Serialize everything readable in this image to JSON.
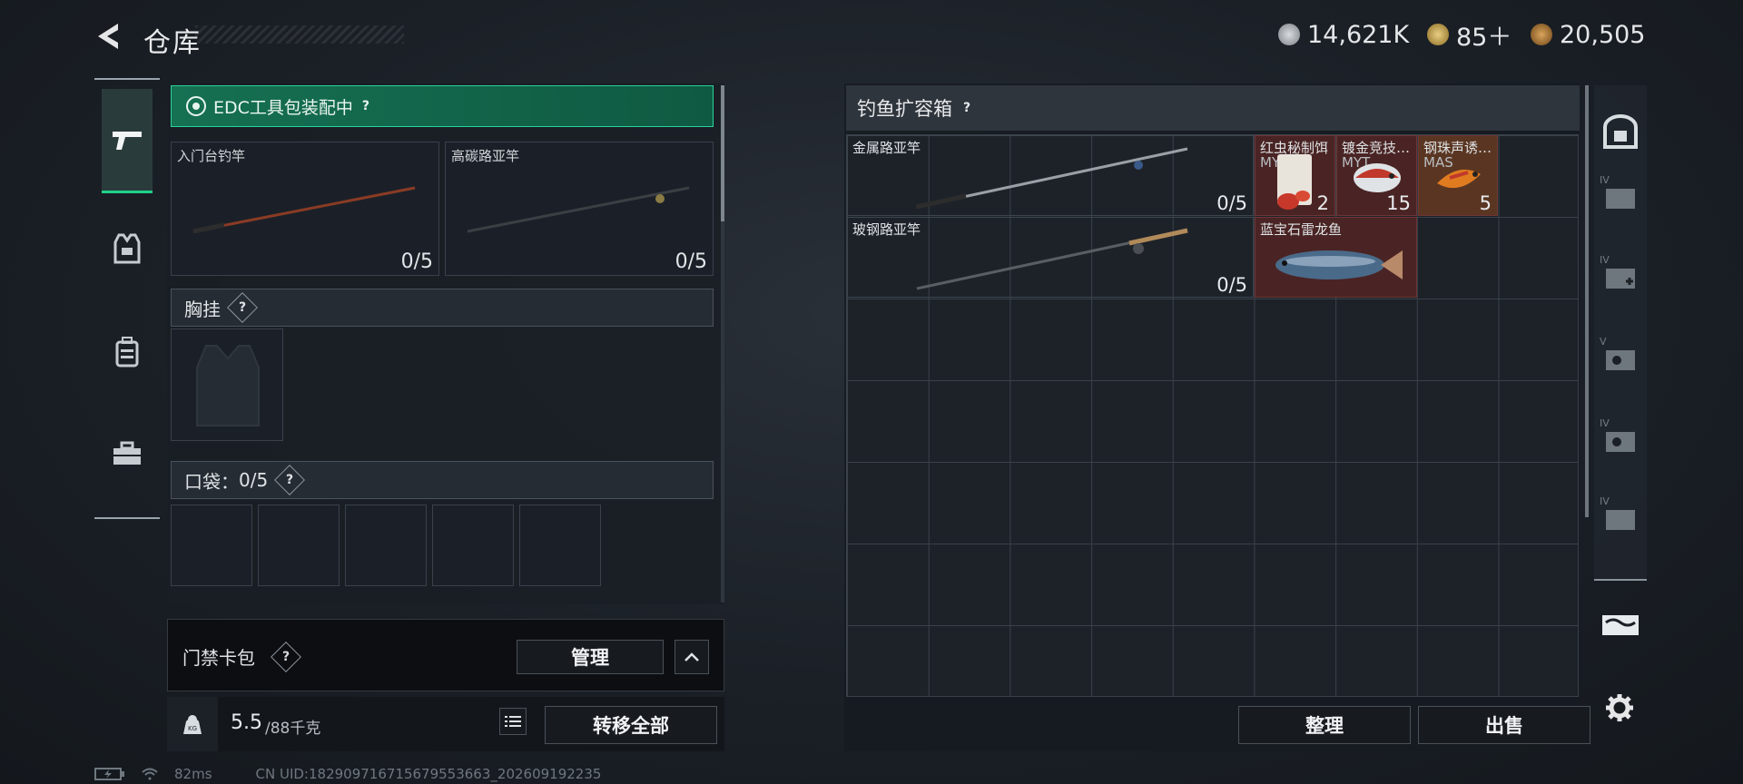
{
  "header": {
    "title": "仓库",
    "currencies": [
      {
        "icon": "silver-coin-icon",
        "value": "14,621K",
        "color": "#b9bcc0"
      },
      {
        "icon": "triangle-token-icon",
        "value": "85＋",
        "color": "#c9a24a"
      },
      {
        "icon": "bronze-coin-icon",
        "value": "20,505",
        "color": "#b5843c"
      }
    ]
  },
  "left_tabs": [
    {
      "icon": "pistol-icon"
    },
    {
      "icon": "vest-icon"
    },
    {
      "icon": "backpack-icon"
    },
    {
      "icon": "toolbox-icon"
    }
  ],
  "edc": {
    "label": "EDC工具包装配中",
    "help": "?"
  },
  "rod_slots": [
    {
      "label": "入门台钓竿",
      "count": "0/5"
    },
    {
      "label": "高碳路亚竿",
      "count": "0/5"
    }
  ],
  "chest": {
    "label": "胸挂",
    "help": "?"
  },
  "pocket": {
    "label": "口袋：",
    "count": "0/5",
    "help": "?"
  },
  "card_wallet": {
    "label": "门禁卡包",
    "help": "?",
    "manage": "管理"
  },
  "weight": {
    "value": "5.5",
    "max": "/88千克",
    "transfer_all": "转移全部"
  },
  "box": {
    "title": "钓鱼扩容箱",
    "help": "?",
    "items": [
      {
        "label": "金属路亚竿",
        "count": "0/5"
      },
      {
        "label": "红虫秘制饵",
        "sub": "MYT",
        "count": "2"
      },
      {
        "label": "镀金竞技…",
        "sub": "MYT",
        "count": "15"
      },
      {
        "label": "钢珠声诱…",
        "sub": "MAS",
        "count": "5"
      },
      {
        "label": "玻钢路亚竿",
        "count": "0/5"
      },
      {
        "label": "蓝宝石雷龙鱼"
      }
    ]
  },
  "bottom_buttons": {
    "organize": "整理",
    "sell": "出售"
  },
  "right_strip": [
    {
      "tier": ""
    },
    {
      "tier": "IV"
    },
    {
      "tier": "IV"
    },
    {
      "tier": "V"
    },
    {
      "tier": "IV"
    },
    {
      "tier": "IV"
    }
  ],
  "status": {
    "ping": "82ms",
    "uid": "CN UID:182909716715679553663_202609192235"
  }
}
